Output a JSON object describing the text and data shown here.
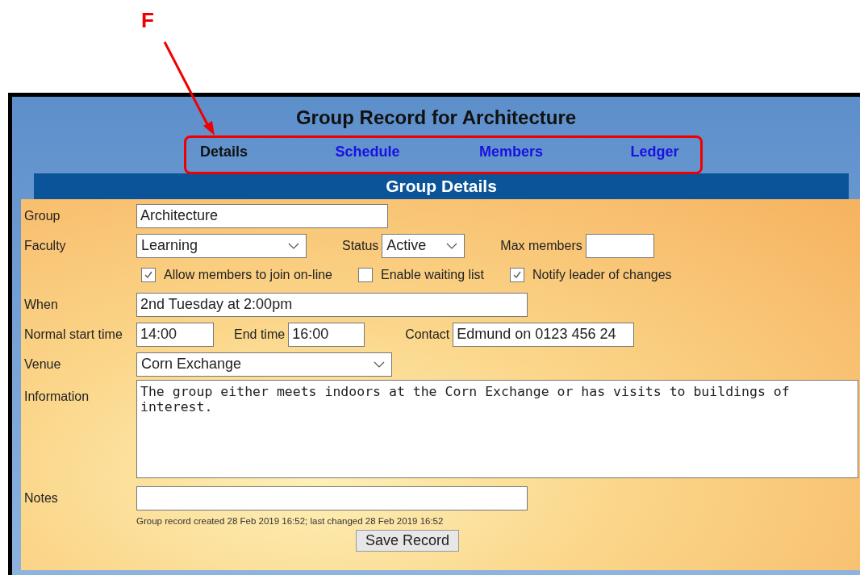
{
  "annotation": {
    "label": "F"
  },
  "title": "Group Record for Architecture",
  "tabs": [
    {
      "label": "Details",
      "selected": true
    },
    {
      "label": "Schedule",
      "selected": false
    },
    {
      "label": "Members",
      "selected": false
    },
    {
      "label": "Ledger",
      "selected": false
    }
  ],
  "section_title": "Group Details",
  "group": {
    "label": "Group",
    "value": "Architecture"
  },
  "faculty": {
    "label": "Faculty",
    "value": "Learning"
  },
  "status": {
    "label": "Status",
    "value": "Active"
  },
  "max_members": {
    "label": "Max members"
  },
  "options": [
    {
      "label": "Allow members to join on-line",
      "checked": true
    },
    {
      "label": "Enable waiting list",
      "checked": false
    },
    {
      "label": "Notify leader of changes",
      "checked": true
    }
  ],
  "when": {
    "label": "When",
    "value": "2nd Tuesday at 2:00pm"
  },
  "start_time": {
    "label": "Normal start time",
    "value": "14:00"
  },
  "end_time": {
    "label": "End time",
    "value": "16:00"
  },
  "contact": {
    "label": "Contact",
    "value": "Edmund on 0123 456 24"
  },
  "venue": {
    "label": "Venue",
    "value": "Corn Exchange"
  },
  "information": {
    "label": "Information",
    "value": "The group either meets indoors at the Corn Exchange or has visits to buildings of interest."
  },
  "notes": {
    "label": "Notes"
  },
  "record_info": "Group record created 28 Feb 2019 16:52; last changed 28 Feb 2019 16:52",
  "save_button": "Save Record"
}
